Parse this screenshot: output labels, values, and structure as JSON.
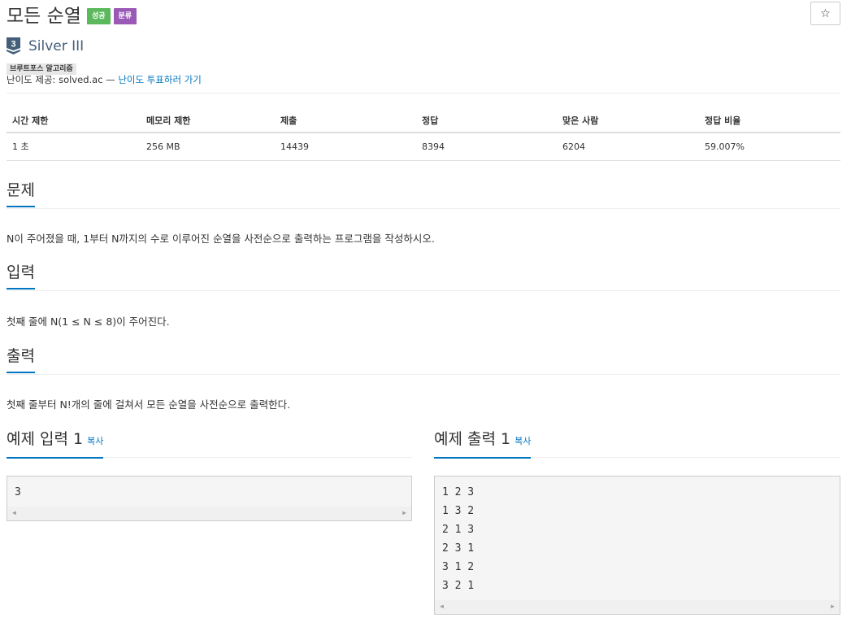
{
  "problem": {
    "title": "모든 순열",
    "badges": {
      "success": "성공",
      "class": "분류"
    },
    "star_glyph": "☆",
    "tier": {
      "number": "3",
      "name": "Silver III"
    },
    "tag": "브루트포스 알고리즘",
    "difficulty": {
      "prefix": "난이도 제공: solved.ac — ",
      "link": "난이도 투표하러 가기"
    }
  },
  "info_table": {
    "headers": [
      "시간 제한",
      "메모리 제한",
      "제출",
      "정답",
      "맞은 사람",
      "정답 비율"
    ],
    "row": [
      "1 초",
      "256 MB",
      "14439",
      "8394",
      "6204",
      "59.007%"
    ]
  },
  "sections": {
    "problem": {
      "title": "문제",
      "text": "N이 주어졌을 때, 1부터 N까지의 수로 이루어진 순열을 사전순으로 출력하는 프로그램을 작성하시오."
    },
    "input": {
      "title": "입력",
      "text": "첫째 줄에 N(1 ≤ N ≤ 8)이 주어진다."
    },
    "output": {
      "title": "출력",
      "text": "첫째 줄부터 N!개의 줄에 걸쳐서 모든 순열을 사전순으로 출력한다."
    }
  },
  "samples": {
    "input": {
      "title": "예제 입력 1",
      "copy": "복사",
      "lines": [
        "3"
      ]
    },
    "output": {
      "title": "예제 출력 1",
      "copy": "복사",
      "lines": [
        "1 2 3",
        "1 3 2",
        "2 1 3",
        "2 3 1",
        "3 1 2",
        "3 2 1"
      ]
    }
  },
  "colors": {
    "link": "#0076c0",
    "success": "#5cb85c",
    "class": "#9b59b6",
    "tier": "#435f7a"
  }
}
